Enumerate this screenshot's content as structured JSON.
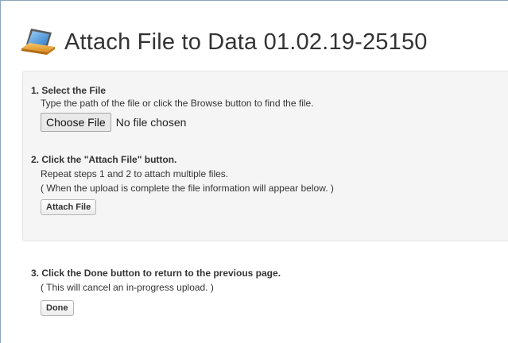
{
  "page": {
    "title": "Attach File to Data 01.02.19-25150",
    "title_icon": "laptop-icon"
  },
  "step1": {
    "heading": "1. Select the File",
    "text": "Type the path of the file or click the Browse button to find the file.",
    "choose_button": "Choose File",
    "file_status": "No file chosen"
  },
  "step2": {
    "heading": "2. Click the \"Attach File\" button.",
    "text1": "Repeat steps 1 and 2 to attach multiple files.",
    "text2": "( When the upload is complete the file information will appear below. )",
    "attach_button": "Attach File"
  },
  "step3": {
    "heading": "3. Click the Done button to return to the previous page.",
    "text": "( This will cancel an in-progress upload. )",
    "done_button": "Done"
  },
  "colors": {
    "panel_bg": "#f5f5f5",
    "frame_border": "#8aa6c1",
    "text": "#333333"
  }
}
